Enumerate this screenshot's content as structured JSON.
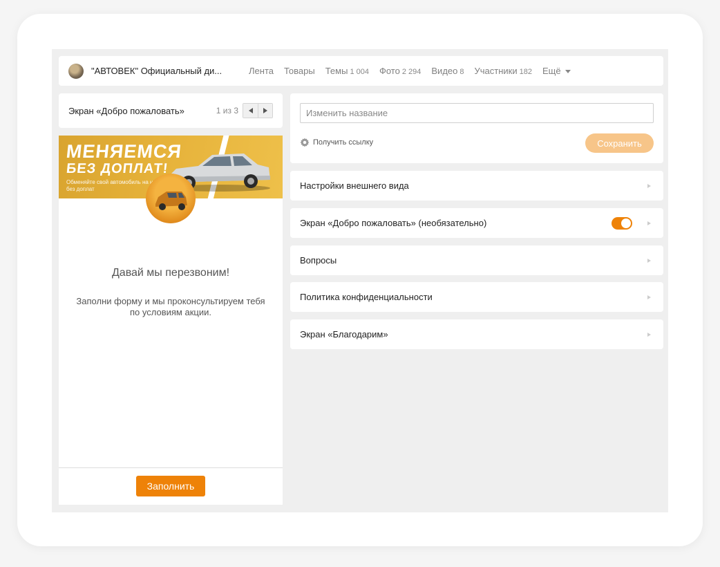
{
  "header": {
    "group_title": "\"АВТОВЕК\" Официальный ди...",
    "nav": [
      {
        "label": "Лента",
        "count": ""
      },
      {
        "label": "Товары",
        "count": ""
      },
      {
        "label": "Темы",
        "count": "1 004"
      },
      {
        "label": "Фото",
        "count": "2 294"
      },
      {
        "label": "Видео",
        "count": "8"
      },
      {
        "label": "Участники",
        "count": "182"
      }
    ],
    "more_label": "Ещё"
  },
  "preview": {
    "screen_title": "Экран «Добро пожаловать»",
    "pager": "1 из 3",
    "banner": {
      "headline": "МЕНЯЕМСЯ",
      "headline2": "БЕЗ ДОПЛАТ!",
      "subtext": "Обменяйте свой автомобиль на новый без доплат"
    },
    "title": "Давай мы перезвоним!",
    "text": "Заполни форму и мы проконсультируем тебя по условиям акции.",
    "button_label": "Заполнить"
  },
  "settings": {
    "name_placeholder": "Изменить название",
    "get_link_label": "Получить ссылку",
    "save_label": "Сохранить",
    "sections": [
      {
        "label": "Настройки внешнего вида"
      },
      {
        "label": "Экран «Добро пожаловать» (необязательно)",
        "toggle": true
      },
      {
        "label": "Вопросы"
      },
      {
        "label": "Политика конфиденциальности"
      },
      {
        "label": "Экран «Благодарим»"
      }
    ]
  },
  "colors": {
    "accent": "#ee8208",
    "accent_light": "#f7c589",
    "background": "#efefef"
  }
}
